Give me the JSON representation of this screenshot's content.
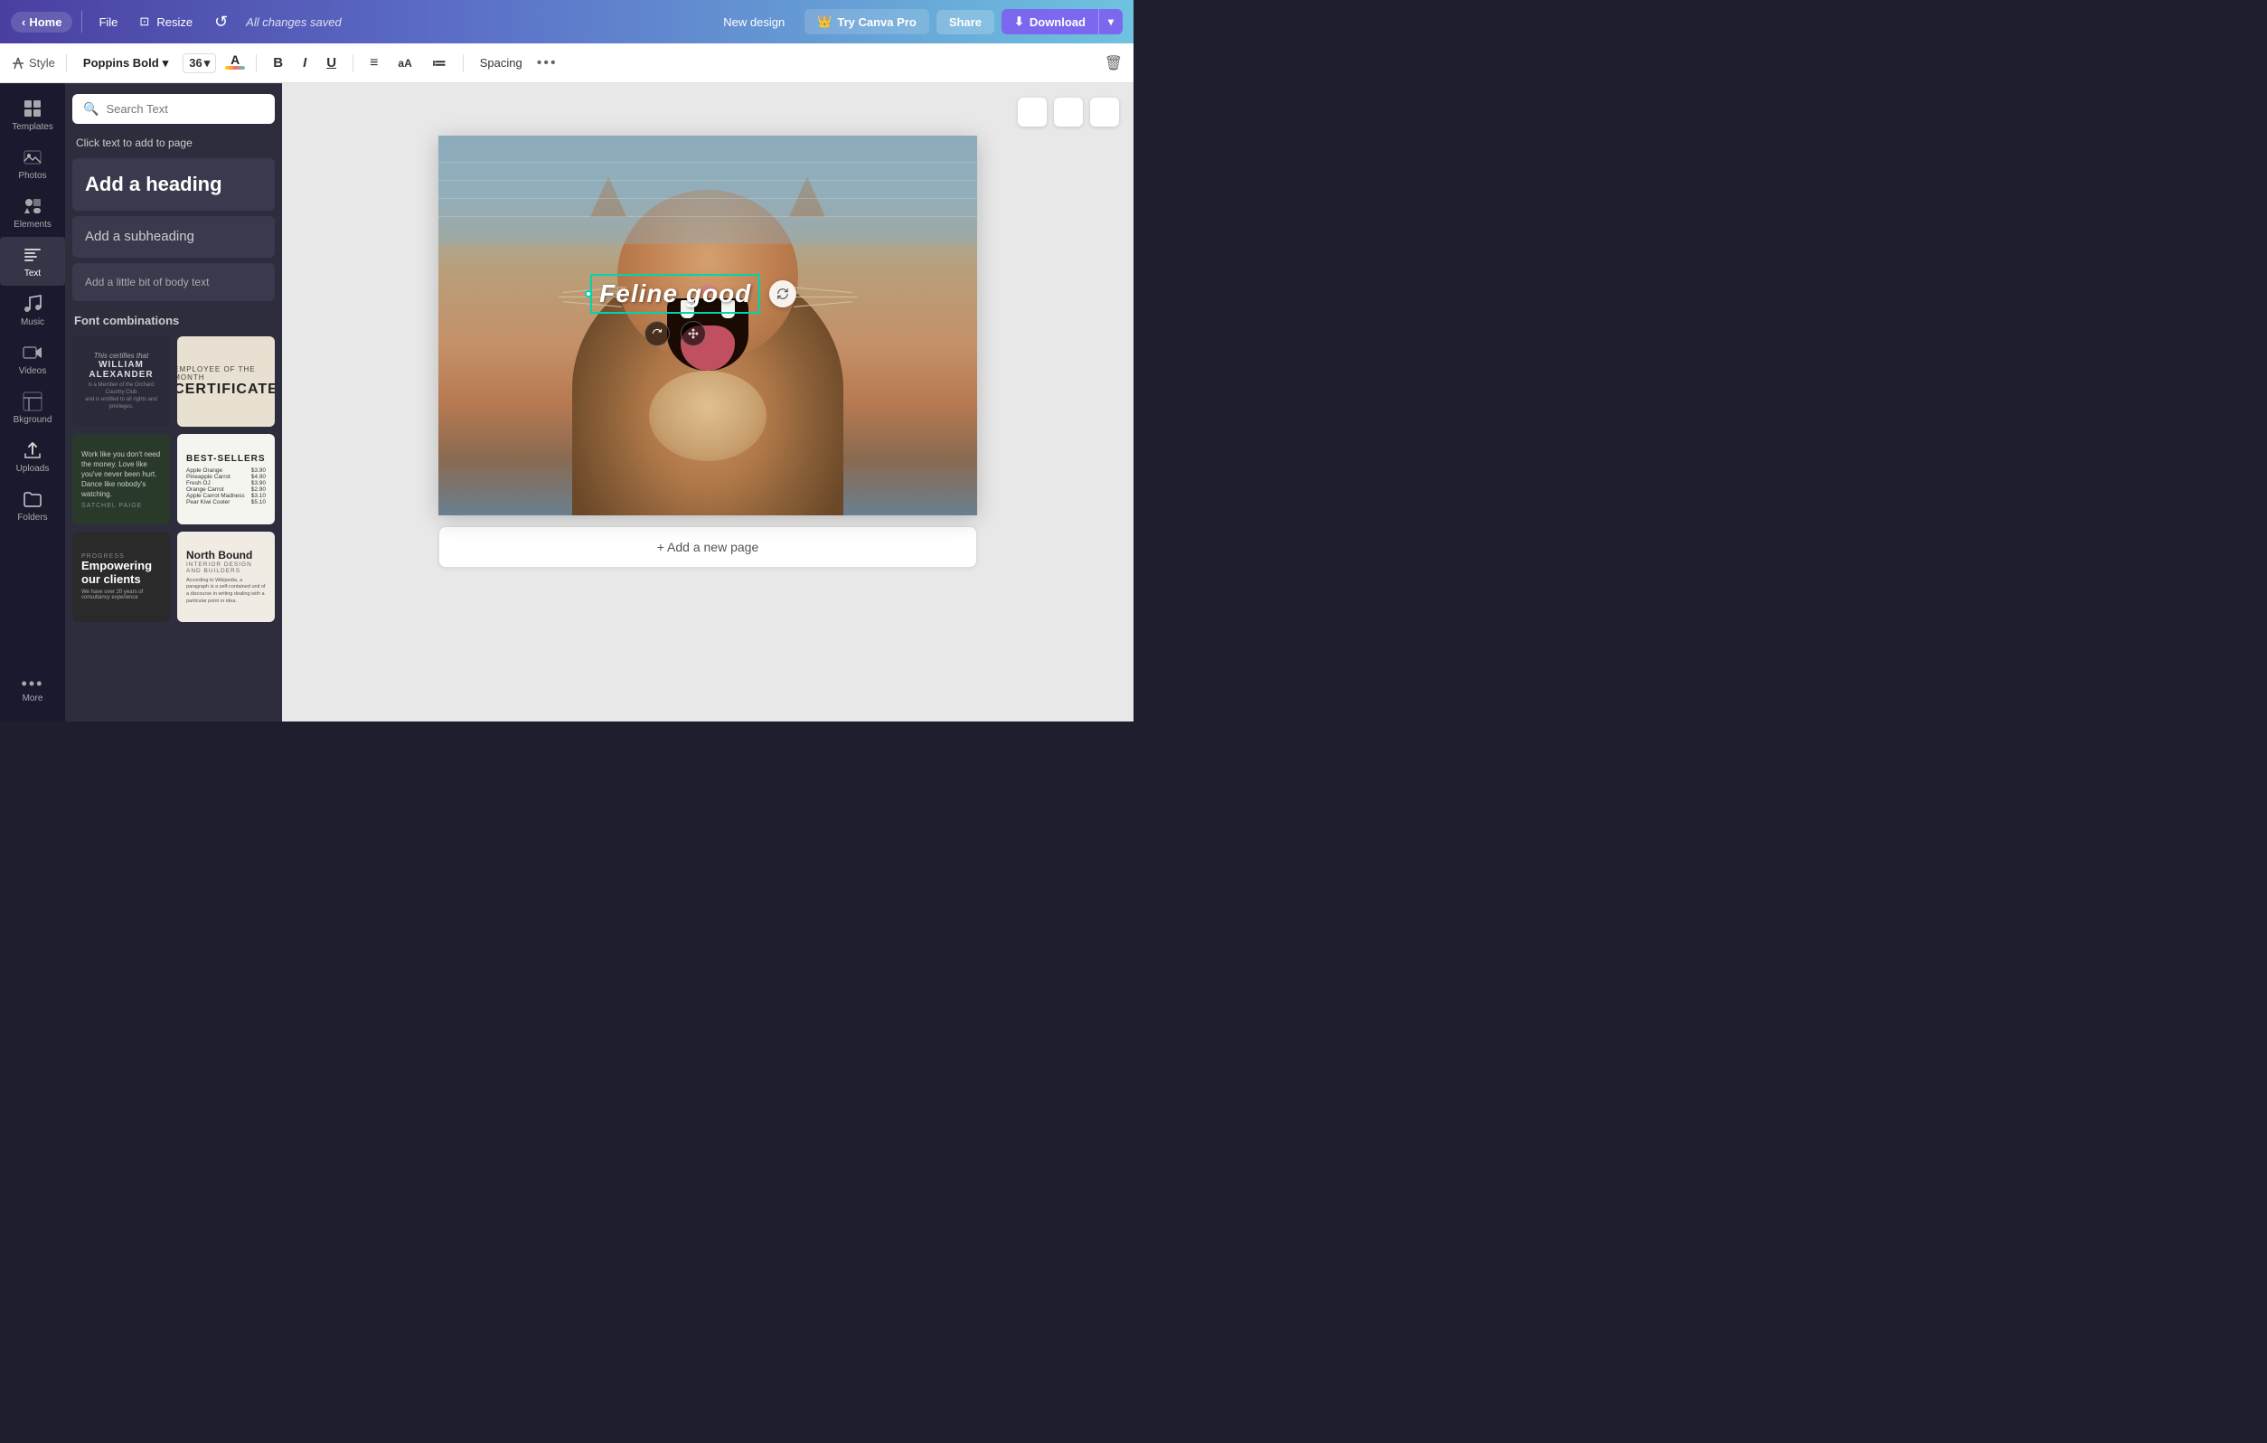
{
  "topnav": {
    "home_label": "Home",
    "file_label": "File",
    "resize_label": "Resize",
    "saved_text": "All changes saved",
    "new_design_label": "New design",
    "try_pro_label": "Try Canva Pro",
    "share_label": "Share",
    "download_label": "Download",
    "crown_icon": "👑",
    "download_icon": "⬇"
  },
  "toolbar": {
    "style_label": "Style",
    "font_name": "Poppins Bold",
    "font_size": "36",
    "bold_label": "B",
    "italic_label": "I",
    "underline_label": "U",
    "align_label": "≡",
    "case_label": "aA",
    "list_label": "≔",
    "spacing_label": "Spacing",
    "more_label": "•••",
    "trash_label": "🗑"
  },
  "sidebar": {
    "items": [
      {
        "id": "templates",
        "label": "Templates",
        "icon": "grid"
      },
      {
        "id": "photos",
        "label": "Photos",
        "icon": "photo"
      },
      {
        "id": "elements",
        "label": "Elements",
        "icon": "shapes"
      },
      {
        "id": "text",
        "label": "Text",
        "icon": "text",
        "active": true
      },
      {
        "id": "music",
        "label": "Music",
        "icon": "music"
      },
      {
        "id": "videos",
        "label": "Videos",
        "icon": "video"
      },
      {
        "id": "background",
        "label": "Bkground",
        "icon": "background"
      },
      {
        "id": "uploads",
        "label": "Uploads",
        "icon": "upload"
      },
      {
        "id": "folders",
        "label": "Folders",
        "icon": "folder"
      }
    ],
    "more_label": "More"
  },
  "text_panel": {
    "search_placeholder": "Search Text",
    "click_hint": "Click text to add to page",
    "heading_text": "Add a heading",
    "subheading_text": "Add a subheading",
    "body_text": "Add a little bit of body text",
    "font_combos_title": "Font combinations",
    "combos": [
      {
        "id": "fc1",
        "style": "dark",
        "italic_line": "This certifies that",
        "name_line": "WILLIAM ALEXANDER",
        "sub_line": "is a Member of the Orchard Country Club and is entitled to all rights and privileges appertaining thereto."
      },
      {
        "id": "fc2",
        "style": "light",
        "cert_line": "EMPLOYEE OF THE MONTH",
        "title_line": "CERTIFICATE"
      },
      {
        "id": "fc3",
        "style": "dark-quote",
        "quote_line": "Work like you don't need the money. Love like you've never been hurt. Dance like nobody's watching.",
        "author_line": "SATCHEL PAIGE"
      },
      {
        "id": "fc4",
        "style": "bestsellers",
        "title": "BEST-SELLERS",
        "rows": [
          {
            "name": "Apple Orange",
            "price": "$3.90"
          },
          {
            "name": "Pineapple Carrot",
            "price": "$4.90"
          },
          {
            "name": "Fresh OJ",
            "price": "$3.90"
          },
          {
            "name": "Orange Carrot",
            "price": "$2.90"
          },
          {
            "name": "Apple Carrot Madness",
            "price": "$3.10"
          },
          {
            "name": "Pear Kiwi Cooler",
            "price": "$5.10"
          }
        ]
      },
      {
        "id": "fc5",
        "style": "empowering",
        "progress_label": "PROGRESS",
        "big_text": "Empowering our clients",
        "sub_text": "We have over 20 years of consultancy experience"
      },
      {
        "id": "fc6",
        "style": "northbound",
        "title": "North Bound",
        "sub": "INTERIOR DESIGN AND BUILDERS",
        "body": "According to Wikipedia, a paragraph is a self-contained unit of a discourse in writing dealing with a particular point or idea. A paragraph consists of one or more sentences. Though not required by the syntax of any language, a paragraph is usually an element of prose."
      }
    ]
  },
  "canvas": {
    "selected_text": "Feline good",
    "add_page_label": "+ Add a new page"
  }
}
